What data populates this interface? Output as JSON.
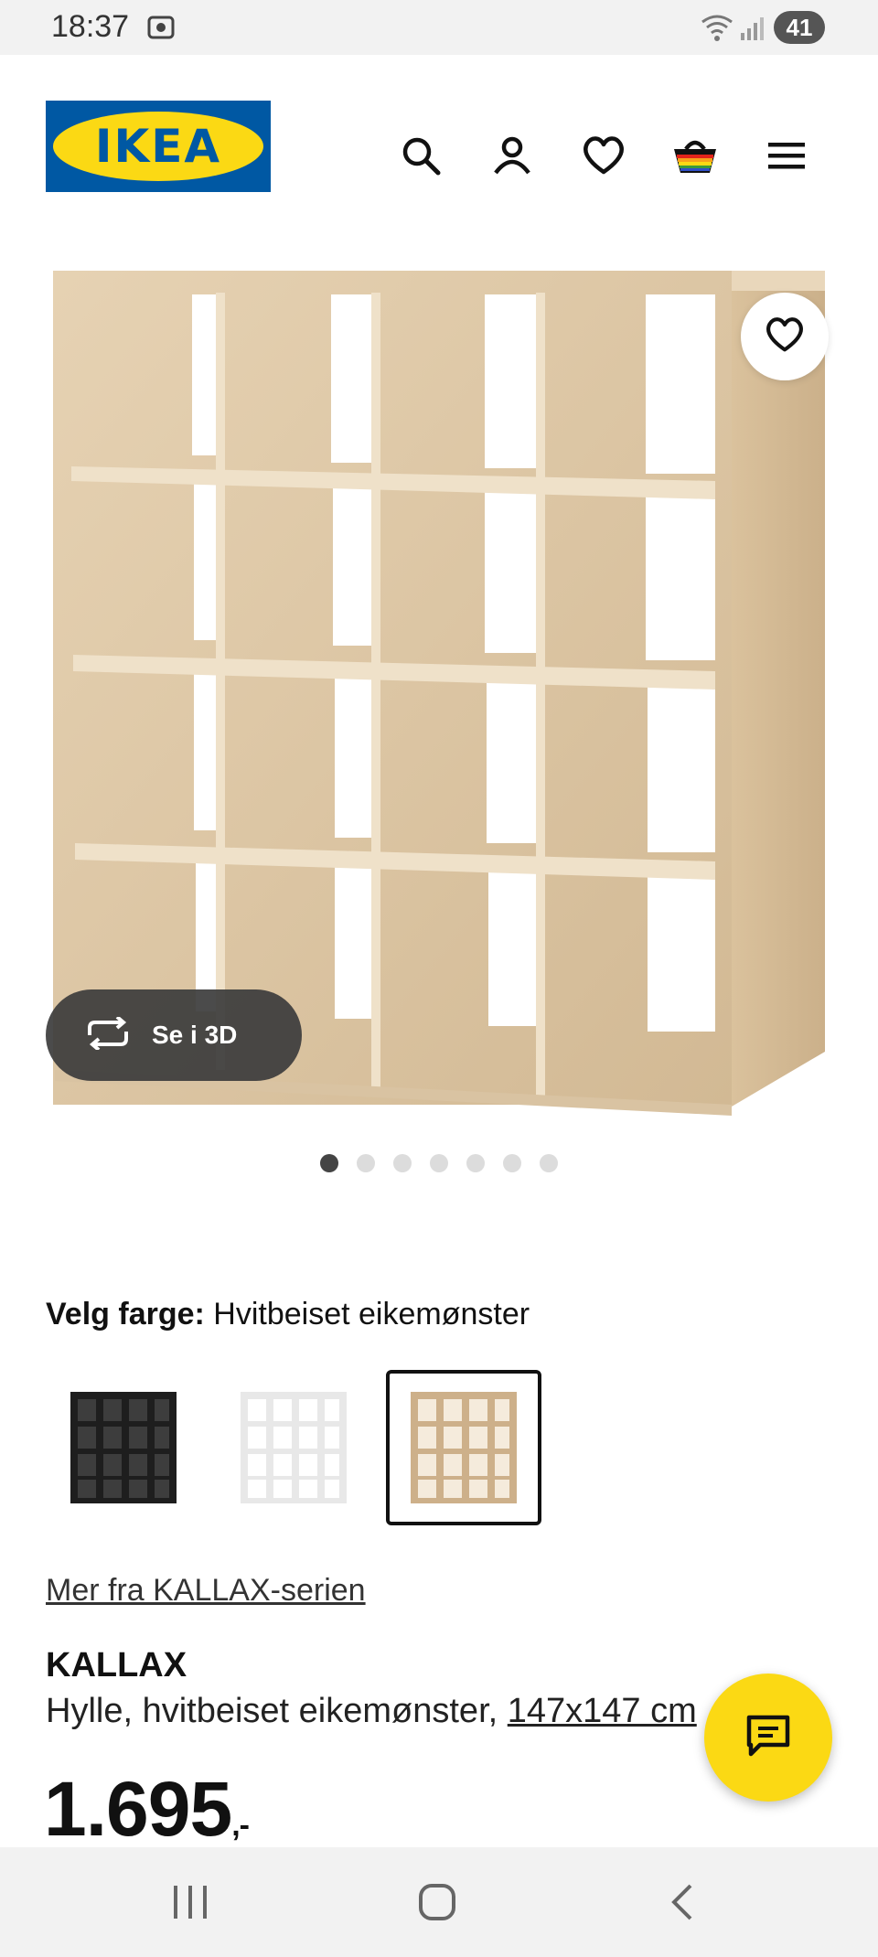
{
  "status_bar": {
    "time": "18:37",
    "battery": "41",
    "icons": [
      "screen-record-icon",
      "wifi-icon",
      "signal-icon",
      "battery-icon"
    ]
  },
  "header": {
    "logo_text": "IKEA",
    "icons": [
      "search-icon",
      "account-icon",
      "heart-icon",
      "basket-icon",
      "menu-icon"
    ],
    "brand_colors": {
      "blue": "#0058a3",
      "yellow": "#fbd914"
    }
  },
  "gallery": {
    "view_3d_label": "Se i 3D",
    "dot_count": 7,
    "active_dot": 1
  },
  "color_chooser": {
    "label": "Velg farge:",
    "selected_value": "Hvitbeiset eikemønster",
    "swatches": [
      {
        "name": "black-brown",
        "color": "#222222",
        "selected": false
      },
      {
        "name": "white",
        "color": "#f4f4f4",
        "selected": false
      },
      {
        "name": "white-stained-oak",
        "color": "#d9c3a2",
        "selected": true
      }
    ]
  },
  "product": {
    "series_link": "Mer fra KALLAX-serien",
    "name": "KALLAX",
    "description": "Hylle, hvitbeiset eikemønster,",
    "size": "147x147 cm",
    "price_main": "1.695",
    "price_suffix": ",-"
  },
  "chat": {
    "icon": "chat-icon"
  },
  "nav_bar": {
    "icons": [
      "recent-apps-icon",
      "home-icon",
      "back-icon"
    ]
  }
}
